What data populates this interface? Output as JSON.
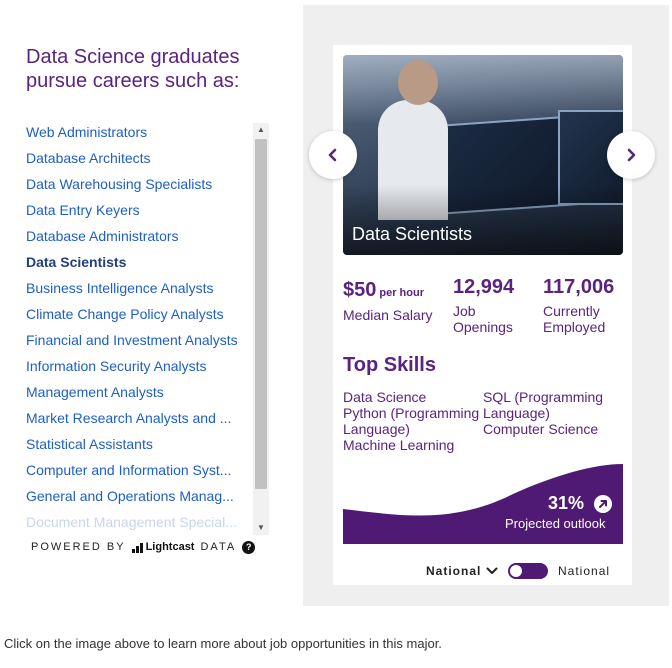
{
  "left": {
    "heading": "Data Science graduates pursue careers such as:",
    "careers": [
      "Web Administrators",
      "Database Architects",
      "Data Warehousing Specialists",
      "Data Entry Keyers",
      "Database Administrators",
      "Data Scientists",
      "Business Intelligence Analysts",
      "Climate Change Policy Analysts",
      "Financial and Investment Analysts",
      "Information Security Analysts",
      "Management Analysts",
      "Market Research Analysts and ...",
      "Statistical Assistants",
      "Computer and Information Syst...",
      "General and Operations Manag...",
      "Document Management Special..."
    ],
    "selected_index": 5,
    "powered_by": "POWERED BY",
    "brand": "Lightcast",
    "data_label": "DATA",
    "help": "?"
  },
  "card": {
    "title": "Data Scientists",
    "salary_value": "$50",
    "salary_unit": "per hour",
    "salary_label": "Median Salary",
    "openings_value": "12,994",
    "openings_label_1": "Job",
    "openings_label_2": "Openings",
    "employed_value": "117,006",
    "employed_label_1": "Currently",
    "employed_label_2": "Employed",
    "skills_title": "Top Skills",
    "skills_col1": [
      "Data Science",
      "Python (Programming",
      "Language)",
      "Machine Learning"
    ],
    "skills_col2": [
      "SQL (Programming",
      "Language)",
      "Computer Science"
    ],
    "outlook_pct": "31%",
    "outlook_label": "Projected outlook"
  },
  "toggle": {
    "left_label": "National",
    "right_label": "National"
  },
  "caption": "Click on the image above to learn more about job opportunities in this major.",
  "colors": {
    "brand_purple": "#5b2380",
    "link_blue": "#1d5fc4",
    "outlook_purple": "#4f1a74"
  }
}
